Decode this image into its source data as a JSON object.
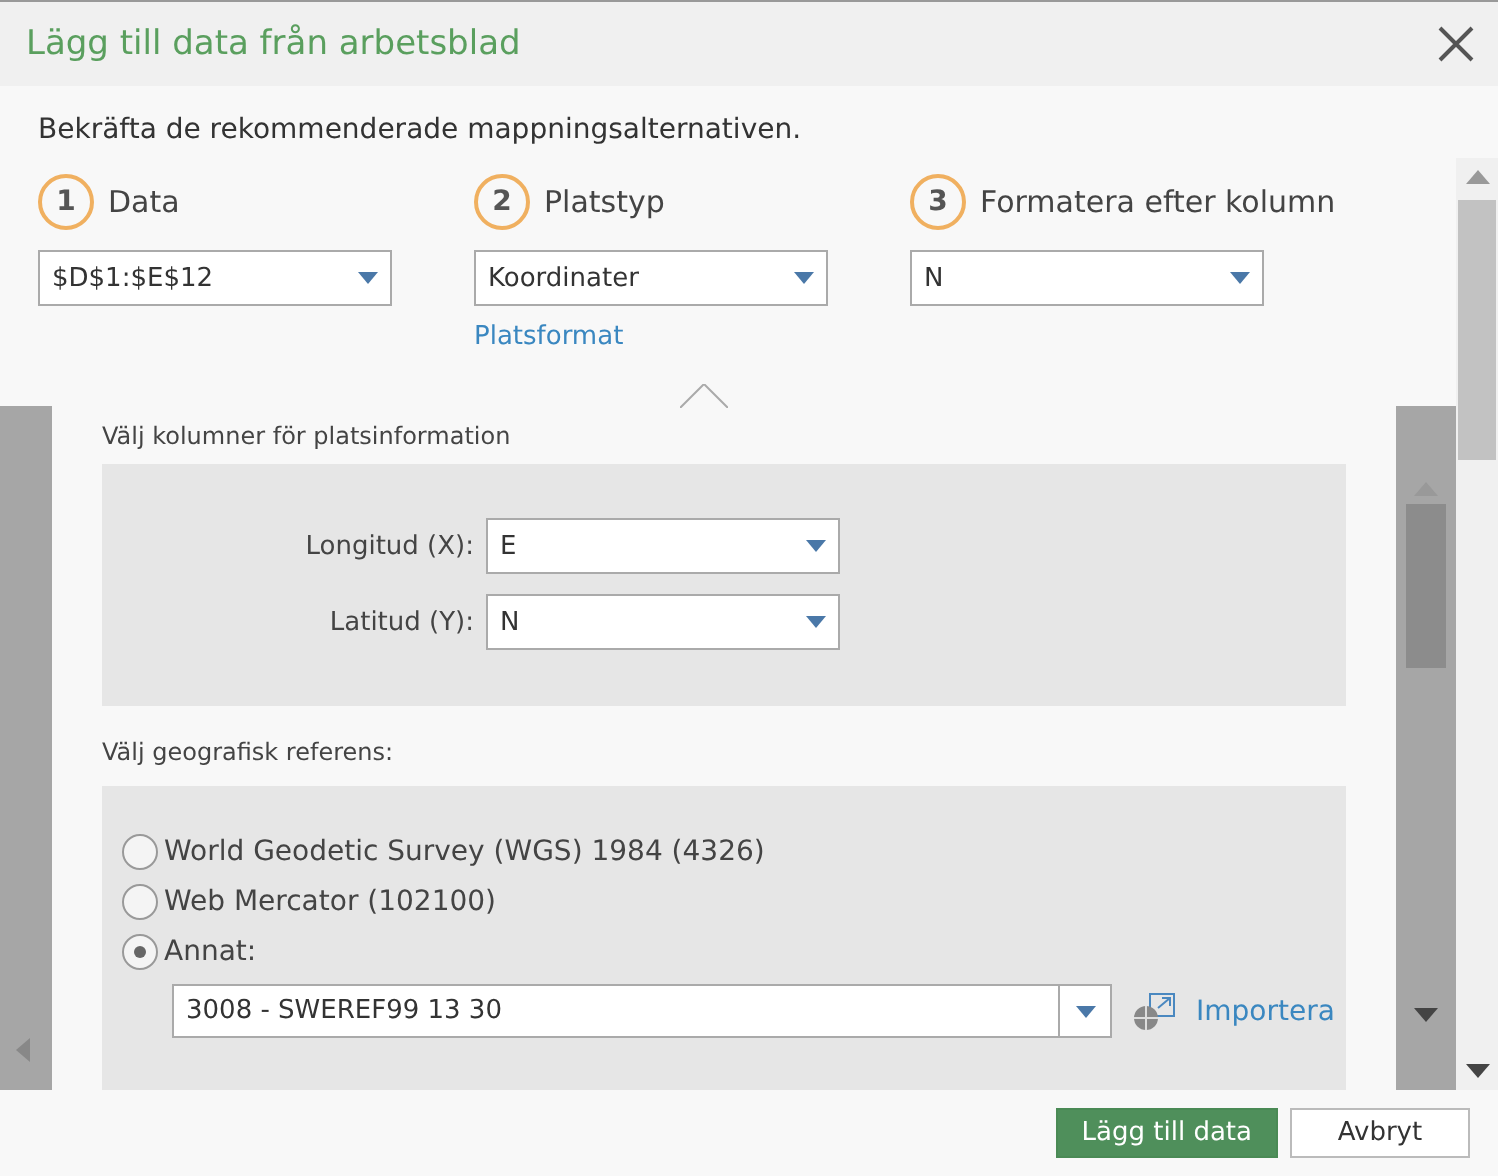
{
  "window": {
    "title": "Lägg till data från arbetsblad"
  },
  "instruction": "Bekräfta de rekommenderade mappningsalternativen.",
  "steps": [
    {
      "number": "1",
      "label": "Data",
      "value": "$D$1:$E$12"
    },
    {
      "number": "2",
      "label": "Platstyp",
      "value": "Koordinater",
      "link": "Platsformat"
    },
    {
      "number": "3",
      "label": "Formatera efter kolumn",
      "value": "N"
    }
  ],
  "popup": {
    "columns_heading": "Välj kolumner för platsinformation",
    "fields": [
      {
        "label": "Longitud (X):",
        "value": "E"
      },
      {
        "label": "Latitud (Y):",
        "value": "N"
      }
    ],
    "reference_heading": "Välj geografisk referens:",
    "options": [
      {
        "label": "World Geodetic Survey (WGS) 1984 (4326)",
        "selected": false
      },
      {
        "label": "Web Mercator (102100)",
        "selected": false
      },
      {
        "label": "Annat:",
        "selected": true
      }
    ],
    "other_value": "3008 - SWEREF99 13 30",
    "import_link": "Importera"
  },
  "buttons": [
    {
      "label": "Lägg till data",
      "kind": "primary"
    },
    {
      "label": "Avbryt",
      "kind": "secondary"
    }
  ]
}
